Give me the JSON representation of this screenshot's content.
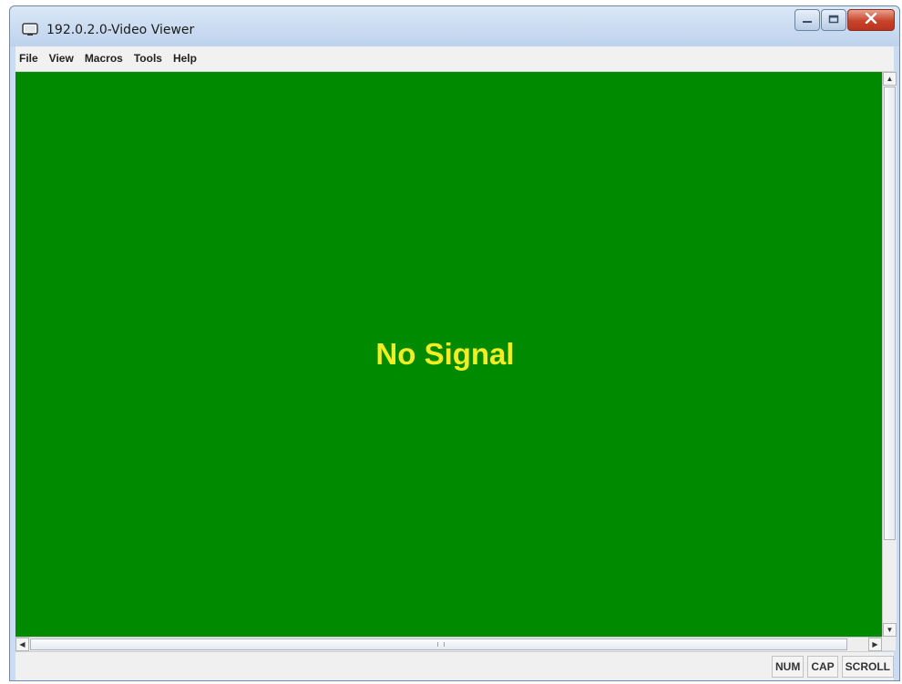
{
  "window": {
    "title": "192.0.2.0-Video Viewer",
    "icons": {
      "app": "monitor-icon",
      "minimize": "minimize-icon",
      "maximize": "maximize-icon",
      "close": "close-icon"
    }
  },
  "menubar": {
    "items": [
      {
        "label": "File"
      },
      {
        "label": "View"
      },
      {
        "label": "Macros"
      },
      {
        "label": "Tools"
      },
      {
        "label": "Help"
      }
    ]
  },
  "viewport": {
    "message": "No Signal",
    "background_color": "#008a00",
    "message_color": "#f2ee22"
  },
  "statusbar": {
    "indicators": [
      {
        "label": "NUM"
      },
      {
        "label": "CAP"
      },
      {
        "label": "SCROLL"
      }
    ]
  }
}
